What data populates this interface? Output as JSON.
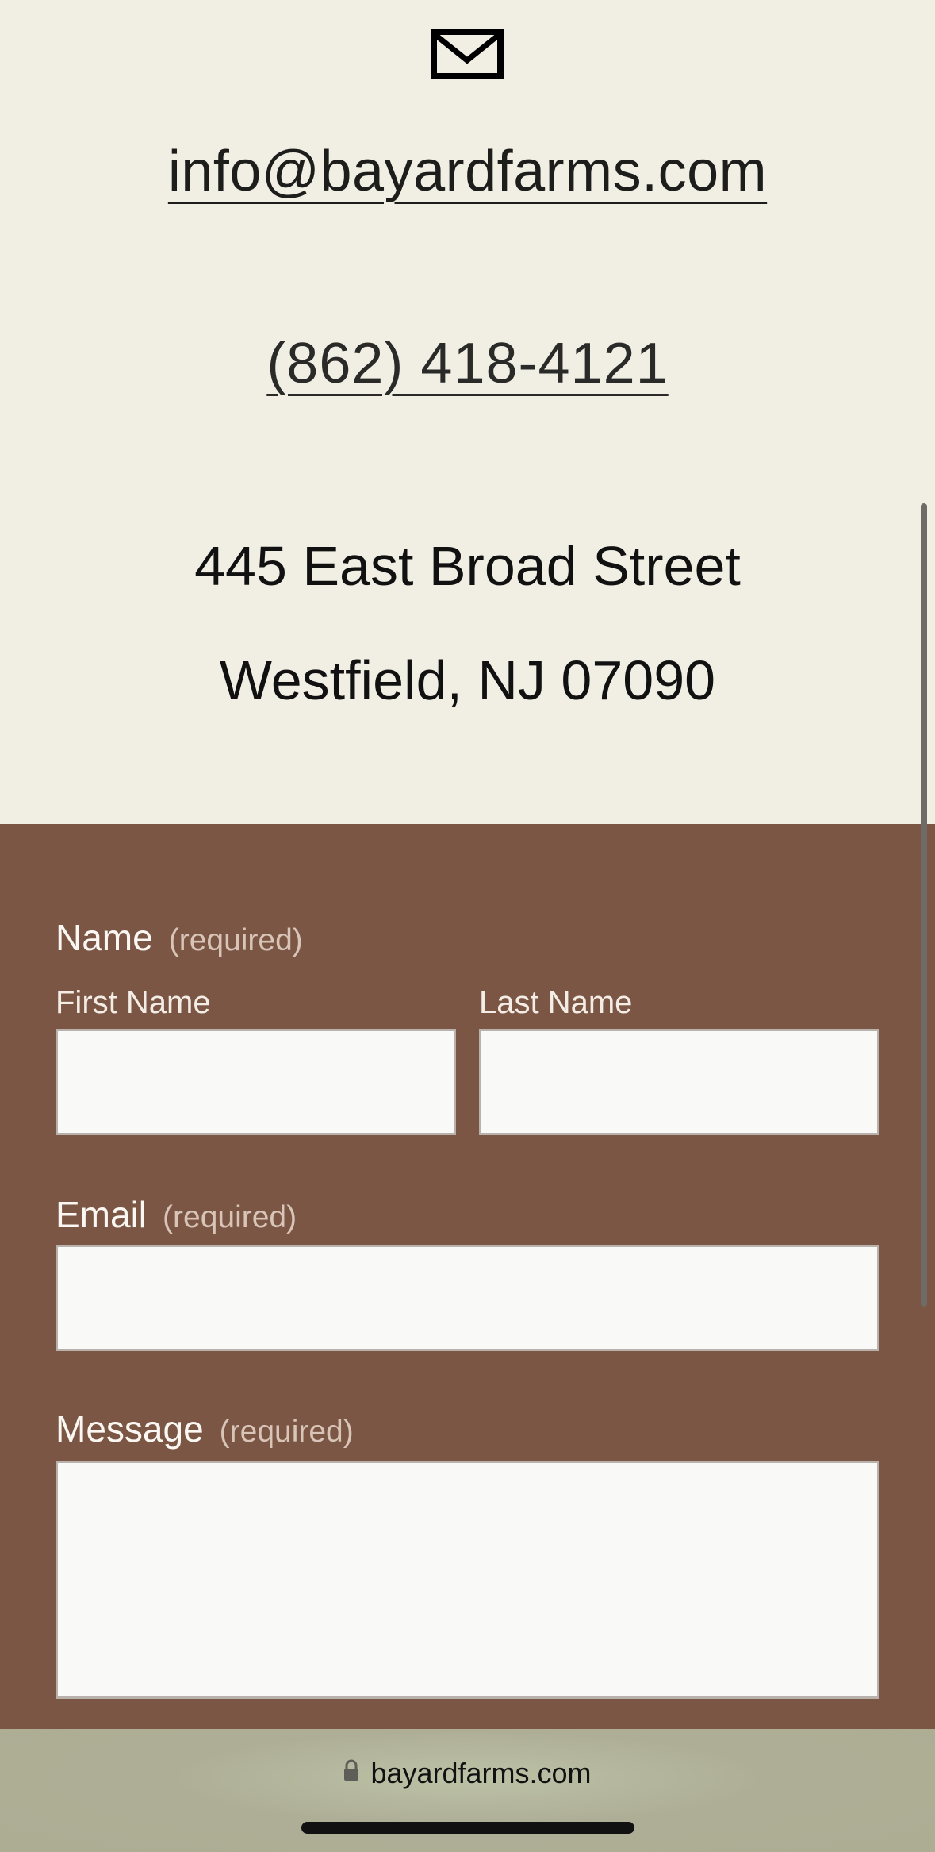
{
  "contact": {
    "icon": "envelope-icon",
    "email": "info@bayardfarms.com",
    "phone": "(862) 418-4121",
    "address_line1": "445 East Broad Street",
    "address_line2": "Westfield, NJ 07090"
  },
  "form": {
    "name_label": "Name",
    "name_required": "(required)",
    "first_name_label": "First Name",
    "first_name_value": "",
    "last_name_label": "Last Name",
    "last_name_value": "",
    "email_label": "Email",
    "email_required": "(required)",
    "email_value": "",
    "message_label": "Message",
    "message_required": "(required)",
    "message_value": ""
  },
  "browser": {
    "url": "bayardfarms.com",
    "lock_icon": "lock-icon"
  },
  "colors": {
    "page_background": "#f1efe4",
    "form_background": "#7b5645",
    "address_bar": "#aeae96"
  }
}
